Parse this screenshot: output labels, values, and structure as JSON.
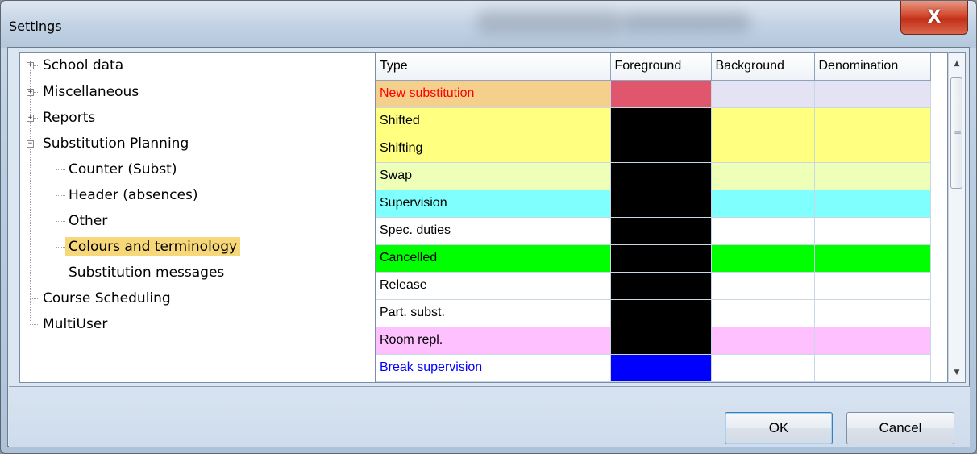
{
  "window": {
    "title": "Settings",
    "close_glyph": "X"
  },
  "tree": {
    "items": [
      {
        "label": "School data",
        "expander": "+"
      },
      {
        "label": "Miscellaneous",
        "expander": "+"
      },
      {
        "label": "Reports",
        "expander": "+"
      },
      {
        "label": "Substitution Planning",
        "expander": "−"
      },
      {
        "label": "Counter (Subst)"
      },
      {
        "label": "Header (absences)"
      },
      {
        "label": "Other"
      },
      {
        "label": "Colours and terminology",
        "selected": true
      },
      {
        "label": "Substitution messages"
      },
      {
        "label": "Course Scheduling"
      },
      {
        "label": "MultiUser"
      }
    ]
  },
  "grid": {
    "columns": [
      "Type",
      "Foreground",
      "Background",
      "Denomination"
    ],
    "rows": [
      {
        "type": "New substitution",
        "text_color": "#ff0000",
        "row_color": "#f5d08c",
        "fg": "#e0566c",
        "bg": "#e3e3f3"
      },
      {
        "type": "Shifted",
        "text_color": "#000000",
        "row_color": "#ffff80",
        "fg": "#000000",
        "bg": "#ffff80"
      },
      {
        "type": "Shifting",
        "text_color": "#000000",
        "row_color": "#ffff80",
        "fg": "#000000",
        "bg": "#ffff80"
      },
      {
        "type": "Swap",
        "text_color": "#000000",
        "row_color": "#eeffb8",
        "fg": "#000000",
        "bg": "#eeffb8"
      },
      {
        "type": "Supervision",
        "text_color": "#000000",
        "row_color": "#80ffff",
        "fg": "#000000",
        "bg": "#80ffff"
      },
      {
        "type": "Spec. duties",
        "text_color": "#000000",
        "row_color": "#ffffff",
        "fg": "#000000",
        "bg": "#ffffff"
      },
      {
        "type": "Cancelled",
        "text_color": "#000000",
        "row_color": "#00ff00",
        "fg": "#000000",
        "bg": "#00ff00"
      },
      {
        "type": "Release",
        "text_color": "#000000",
        "row_color": "#ffffff",
        "fg": "#000000",
        "bg": "#ffffff"
      },
      {
        "type": "Part. subst.",
        "text_color": "#000000",
        "row_color": "#ffffff",
        "fg": "#000000",
        "bg": "#ffffff"
      },
      {
        "type": "Room repl.",
        "text_color": "#000000",
        "row_color": "#ffc0ff",
        "fg": "#000000",
        "bg": "#ffc0ff"
      },
      {
        "type": "Break supervision",
        "text_color": "#0000ff",
        "row_color": "#ffffff",
        "fg": "#0000ff",
        "bg": "#ffffff"
      }
    ]
  },
  "scrollbar": {
    "up_glyph": "▲",
    "down_glyph": "▼",
    "grip_glyph": "≡"
  },
  "buttons": {
    "ok": "OK",
    "cancel": "Cancel"
  }
}
